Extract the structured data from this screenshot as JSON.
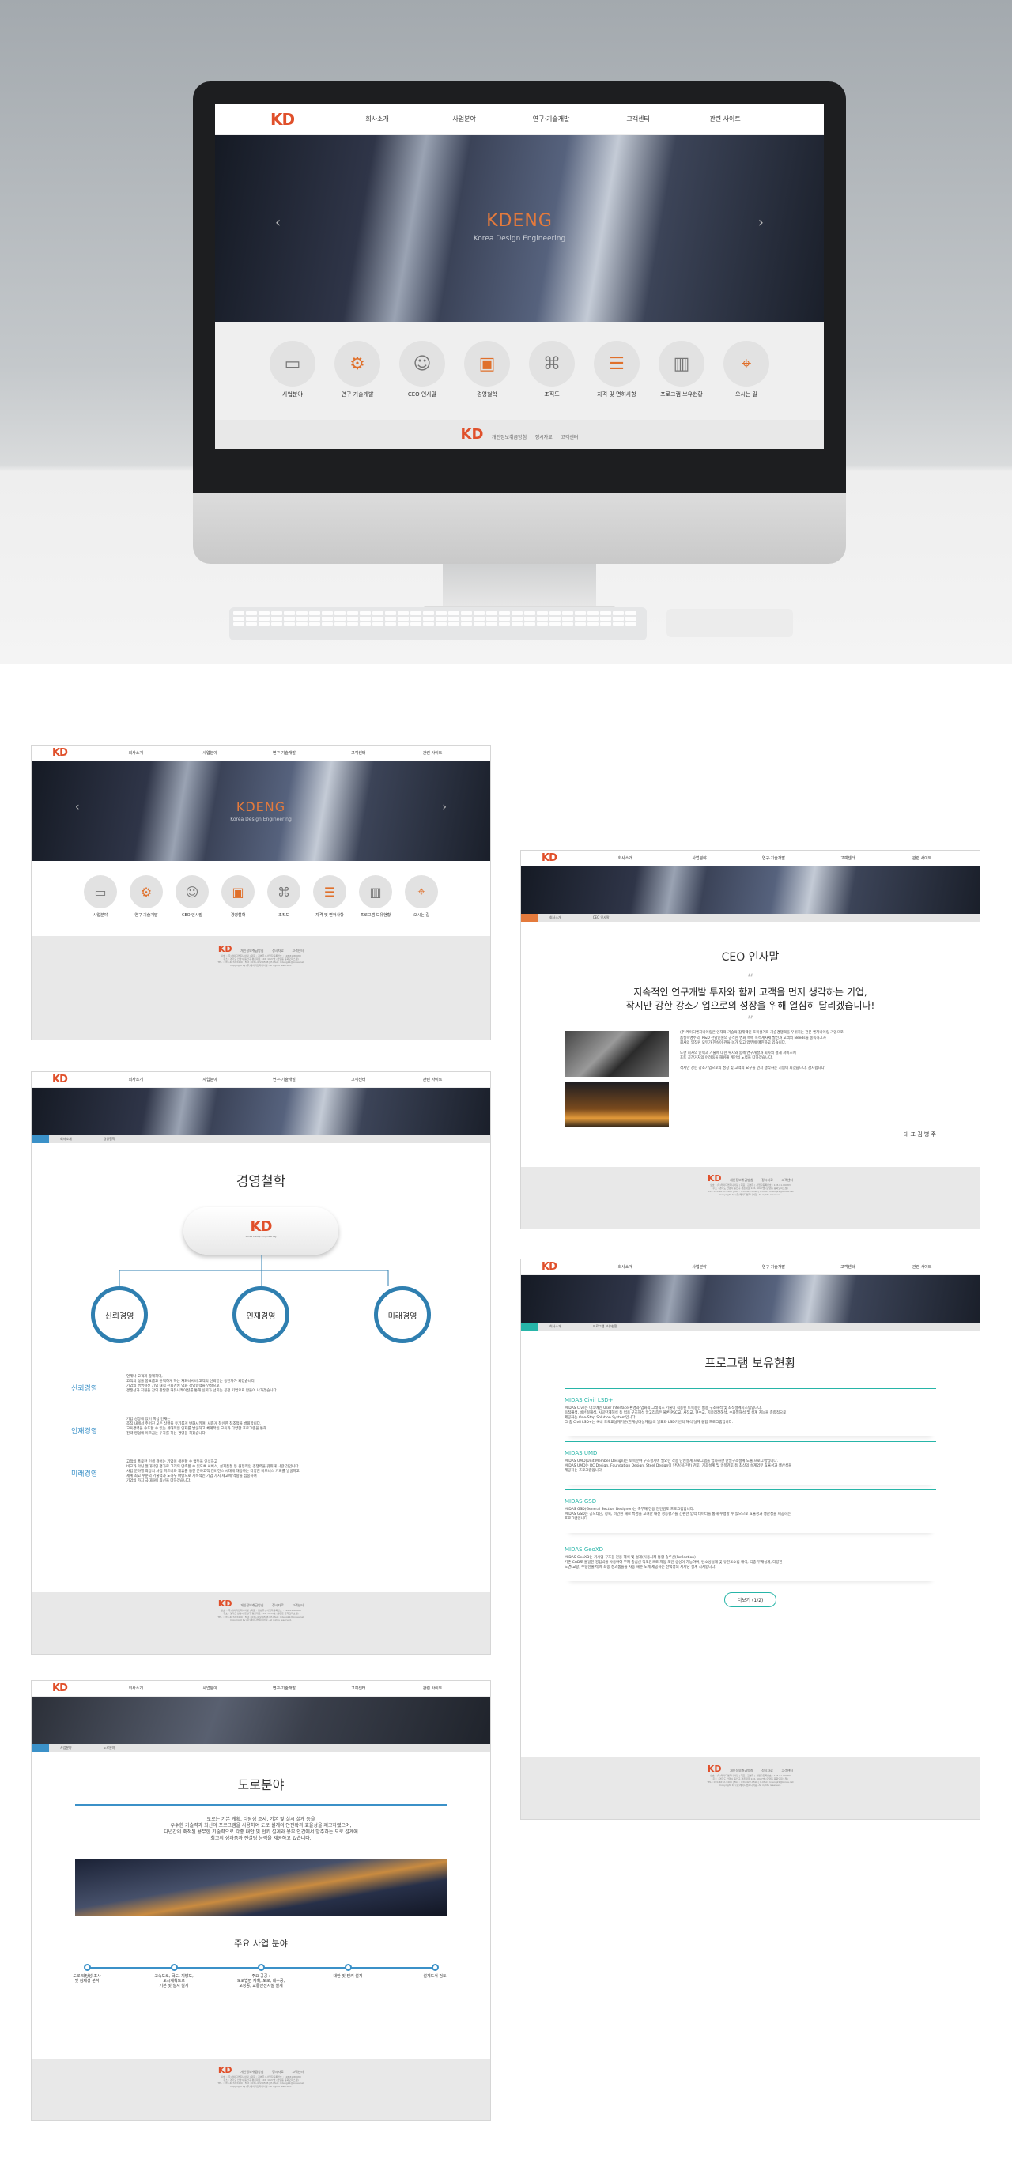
{
  "brand": {
    "logo_kd": "KD",
    "tagline": "Korea Design Engineering"
  },
  "nav": [
    "회사소개",
    "사업분야",
    "연구·기술개발",
    "고객센터",
    "관련 사이트"
  ],
  "hero": {
    "title": "KDENG",
    "subtitle": "Korea Design Engineering"
  },
  "quick_links": [
    "사업분야",
    "연구·기술개발",
    "CEO 인사말",
    "경영철학",
    "조직도",
    "자격 및 면허사항",
    "프로그램 보유현황",
    "오시는 길"
  ],
  "footer": {
    "links": [
      "개인정보취급방침",
      "정시자료",
      "고객센터"
    ],
    "info": [
      "실호 : (주)케이디엔지니어링 | 대표 : 김병주 | 사업자등록번호 : 128-81-86683",
      "주소 : 경기도 안양시 동안구 평촌대로 126, 1027호 (관양동 동화오피스텔)",
      "TEL : 070-4672-3400 | FAX : 031-422-9598 | E-Mail : kdeng21@korea.net",
      "Copyright by (주)케이디엔지니어링. All rights reserved."
    ]
  },
  "ceo": {
    "breadcrumb": [
      "회사소개",
      "CEO 인사말"
    ],
    "title": "CEO 인사말",
    "quote1": "지속적인 연구개발 투자와 함께 고객을 먼저 생각하는 기업,",
    "quote2": "작지만 강한 강소기업으로의 성장을 위해 열심히 달리겠습니다!",
    "body": [
      "(주)케이디엔지니어링은 인재와 기술의 잠재력인 토목설계와 기술경쟁력을 우위하는 전문 엔지니어링 기업으로",
      "품질혁명주의, R&D 전담인원의 공격한 변화 속에 옥석계사제 발전과 고객의 Needs를 충족하고자",
      "회사의 임직원 모두가 진실이 관들 농가 있고 업무에 매진하고 있습니다.",
      "또한 회사의 인력과 기술에 대한 투자와 함께 연구개발과 회사의 설계 서비스에",
      "포토 공간거처의 어려움을 해위해 계인의 노력을 다하겠습니다.",
      "작지만 강한 강소기업으로의 성장 및 고객의 요구를 먼저 생각하는 기업이 되겠습니다. 감사합니다."
    ],
    "sign": "대 표  김 병 주"
  },
  "phil": {
    "breadcrumb": [
      "회사소개",
      "경영철학"
    ],
    "title": "경영철학",
    "circles": [
      "신뢰경영",
      "인재경영",
      "미래경영"
    ],
    "rows": [
      {
        "label": "신뢰경영",
        "text": [
          "언제나 고객과 함께하며,",
          "고객의 삶을 풍요롭고 윤택하게 하는 재화나서비 고객의 신뢰받는 동반자가 되겠습니다.",
          "기업의 경영혁신 기업 내적 신뢰경영 약화 경영협력을 인정으로",
          "경쟁선과 직원들 간의 활발한 커뮤니케이션를 통해 신뢰가 넘치는 공정 기업으로 만들어 나가겠습니다."
        ]
      },
      {
        "label": "인재경영",
        "text": [
          "기업 성장에 있어 핵심 인재는",
          "조직 내에서 주어진 모든 상황을 유기롭게 변화시키며, 새롭게 창신한 창조적을 발휘합니다.",
          "교육경력을 수도할 수 있는 세대적인 인재를 발굴하고 체계적인 교육과 다양한 프로그램을 통해",
          "전략 영업에 이르끔는 두자를 하는 경영을 하겠습니다."
        ]
      },
      {
        "label": "미래경영",
        "text": [
          "고객의 풍료한 인생 걸어는 기업이 생존할 수 없듯을 인식하고",
          "비교가 아닌 절대적인 평가로 고객의 만족할 수 있도록 서비스, 설계품질 등 원형적인 경쟁력을 갖춰해 나갈 것입니다.",
          "사업 분야별 최상의 사업 파트너와 제휴를 통한 분야고객 컨버전스 시대에 대응하는 다양한 비즈니스 기회를 발굴하고,",
          "세계 최고 수준의 기술력과 노하우 바탕으로 계속적인 기업 가치 제고에 역량을 집중하여",
          "기업의 가치 극대화에 최선을 다하겠습니다."
        ]
      }
    ]
  },
  "prog": {
    "breadcrumb": [
      "회사소개",
      "프로그램 보유현황"
    ],
    "title": "프로그램 보유현황",
    "items": [
      {
        "name": "MIDAS Civil LSD+",
        "text": [
          "MIDAS Civil은 마코에인 User Interface 환경과 엄화의 그래픽스 기술이 적용된 토목용한 범용 구조해석 및 최적설계시스템입니다.",
          "동적해석, 비선형해석, 시공단계해석 등 범용 구조해석 알고리즘은 물론 PSC교, 사장교, 현수교, 지중래장해석, 수화열해석 및 설계 지능을 종합적으로",
          "제공하는 One-Stop Solution System입니다.",
          "그 중 Civil LSD+는 국내 도로교설계기준(한계상태설계법)의 발표와 LSD기반의 해석/설계 통합 프로그램입니다."
        ]
      },
      {
        "name": "MIDAS UMD",
        "text": [
          "MIDAS UMD(Unit Member Design)는 토목분야 구조설계에 필요한 각종 단면설계 프로그램을 엄화하한 단일구조설계 도출 프로그램입니다.",
          "MIDAS UMD는 RC Design, Foundation Design, Steel Design이 단면(철근완) 검토, 기초설계 및 골목검토 등 최상의 설계업무 효율성과 생산성을",
          "제공하는 프로그램입니다."
        ]
      },
      {
        "name": "MIDAS GSD",
        "text": [
          "MIDAS GSD(General Section Designer)는 축부재 전용 단면검토 프로그램입니다.",
          "MIDAS GSD는 공으타단, 정육, 비인원 새로 특성을 고려한 내진 성능평가를 간편한 입력 테이터를 통해 수행할 수 있으므로 효율성과 생산성을 제공하는",
          "프로그램입니다."
        ]
      },
      {
        "name": "MIDAS GeoXD",
        "text": [
          "MIDAS GeoXD는 기시업 구조물 전용 해석 및 설계(사용사례 통합 솔루션(Reflection)",
          "기존 CAD로 돌일한 영업박을 사용하여 부재 중심선 작도만으로 자동 도면 생성이 가능하며, 탄소성설계 및 유한요소법 해석, 각종 부재설계, 다양한",
          "도면(교량, 수량산출서)에 최종 성과품들을 자동 해준 도에 제공하는 선택성의 지시당 설계 지시합니다."
        ]
      }
    ],
    "more": "더보기 (1/2)"
  },
  "road": {
    "breadcrumb": [
      "사업분야",
      "도로분야"
    ],
    "title": "도로분야",
    "intro": [
      "도로는 기본 계획, 타당성 조사, 기본 및 실시 설계 등을",
      "우수한 기술력과 최신의 프로그램을 사용하여 도로 설계의 안전확과 효율성을 제고하였으며,",
      "다년간의 축적된 용무한 기술력으로 각종 대안 및 턴키 설계와 용부 인간에서 발주하는 도로 설계에",
      "최고의 성과품과 진설팅 능력을 제공하고 있습니다."
    ],
    "sub": "주요 사업 분야",
    "timeline": [
      "도로 타당성 조사\n및 검제성 분석",
      "고속도로, 국도, 지방도,\n도시계획도로\n기본 및 실시 설계",
      "주요 공공 :\n도로법면 계획, 도로, 배수공,\n포장공, 교통안전시설 설계",
      "대안 및 턴키 설계",
      "설계도서 검토"
    ]
  }
}
